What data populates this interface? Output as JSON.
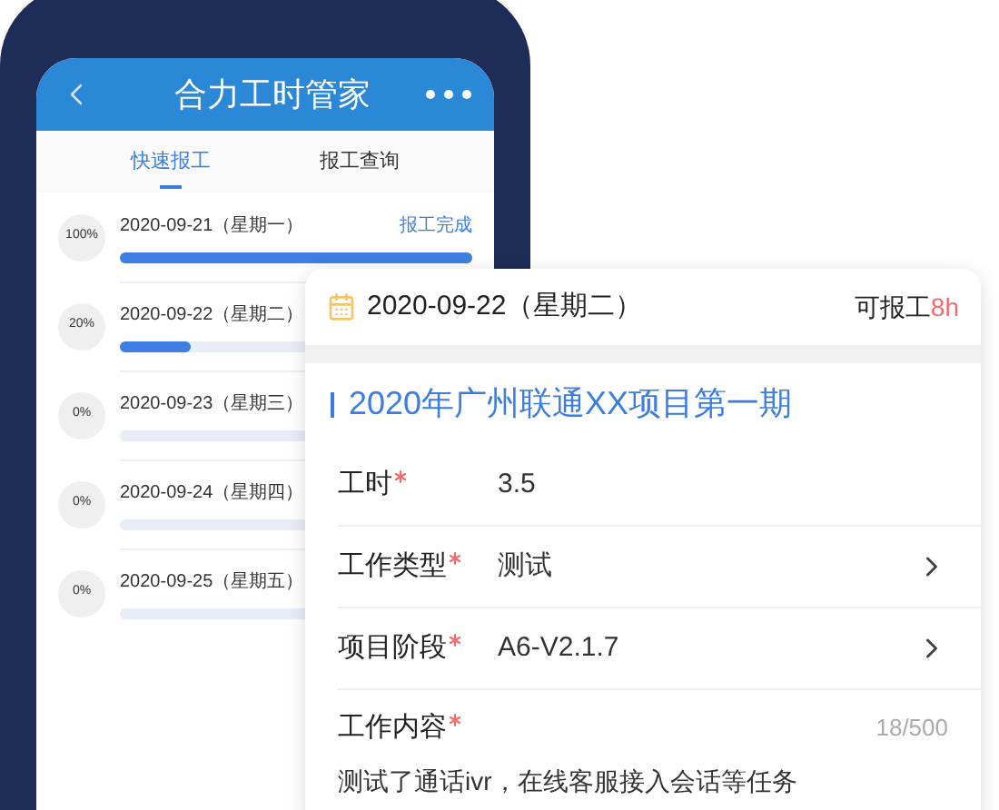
{
  "phone": {
    "title": "合力工时管家",
    "tabs": [
      {
        "label": "快速报工",
        "selected": true
      },
      {
        "label": "报工查询",
        "selected": false
      }
    ],
    "days": [
      {
        "percent": "100%",
        "date": "2020-09-21（星期一）",
        "status": "报工完成",
        "level": 1
      },
      {
        "percent": "20%",
        "date": "2020-09-22（星期二）",
        "level": 0.2
      },
      {
        "percent": "0%",
        "date": "2020-09-23（星期三）",
        "level": 0
      },
      {
        "percent": "0%",
        "date": "2020-09-24（星期四）",
        "level": 0
      },
      {
        "percent": "0%",
        "date": "2020-09-25（星期五）",
        "level": 0
      }
    ]
  },
  "card": {
    "date": "2020-09-22（星期二）",
    "available_label": "可报工",
    "available_hours": "8h",
    "project": "2020年广州联通XX项目第一期",
    "fields": [
      {
        "kind": "text",
        "label": "工时",
        "required": true,
        "value": "3.5"
      },
      {
        "kind": "select",
        "label": "工作类型",
        "required": true,
        "value": "测试"
      },
      {
        "kind": "select",
        "label": "项目阶段",
        "required": true,
        "value": "A6-V2.1.7"
      },
      {
        "kind": "textarea",
        "label": "工作内容",
        "required": true,
        "counter": "18/500",
        "value": "测试了通话ivr，在线客服接入会话等任务"
      }
    ]
  }
}
